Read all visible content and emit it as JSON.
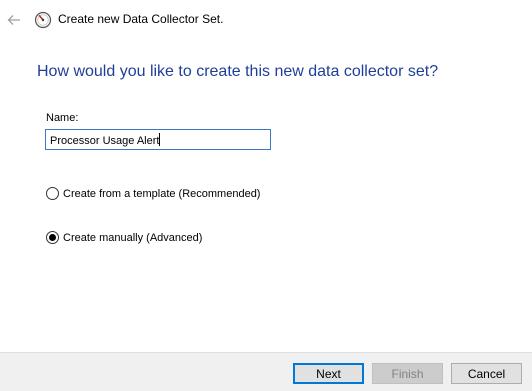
{
  "window": {
    "title": "Create new Data Collector Set.",
    "back_icon": "arrow-left-icon",
    "app_icon": "performance-monitor-icon"
  },
  "heading": "How would you like to create this new data collector set?",
  "name_field": {
    "label": "Name:",
    "value": "Processor Usage Alert"
  },
  "options": [
    {
      "label": "Create from a template (Recommended)",
      "selected": false
    },
    {
      "label": "Create manually (Advanced)",
      "selected": true
    }
  ],
  "buttons": {
    "next": "Next",
    "finish": "Finish",
    "cancel": "Cancel"
  },
  "colors": {
    "heading": "#1f3f99",
    "input_border": "#3b79c7",
    "default_button_border": "#0078d7"
  }
}
